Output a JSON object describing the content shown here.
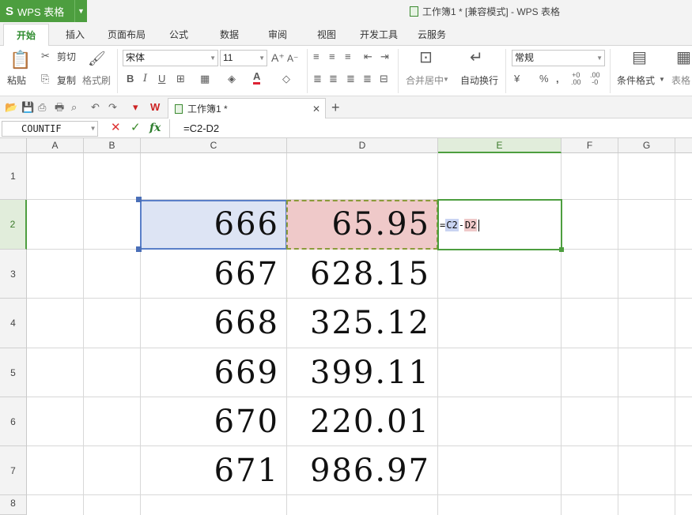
{
  "app": {
    "menu_label": "WPS 表格",
    "window_title": "工作簿1 * [兼容模式] - WPS 表格"
  },
  "tabs": [
    "开始",
    "插入",
    "页面布局",
    "公式",
    "数据",
    "审阅",
    "视图",
    "开发工具",
    "云服务"
  ],
  "ribbon": {
    "paste": "粘贴",
    "cut": "剪切",
    "copy": "复制",
    "format_painter": "格式刷",
    "font_name": "宋体",
    "font_size": "11",
    "merge_center": "合并居中",
    "wrap_text": "自动换行",
    "number_format": "常规",
    "conditional_format": "条件格式",
    "table_style": "表格"
  },
  "document_tab": {
    "name": "工作簿1 *"
  },
  "formula_bar": {
    "name_box": "COUNTIF",
    "fx": "fx",
    "formula": "=C2-D2"
  },
  "sheet": {
    "columns": [
      "A",
      "B",
      "C",
      "D",
      "E",
      "F",
      "G"
    ],
    "rows": [
      "1",
      "2",
      "3",
      "4",
      "5",
      "6",
      "7",
      "8"
    ],
    "selected_column": "E",
    "selected_row": "2",
    "values": {
      "C2": "666",
      "D2": "65.95",
      "C3": "667",
      "D3": "628.15",
      "C4": "668",
      "D4": "325.12",
      "C5": "669",
      "D5": "399.11",
      "C6": "670",
      "D6": "220.01",
      "C7": "671",
      "D7": "986.97"
    },
    "edit_cell": {
      "eq": "=",
      "ref1": "C2",
      "op": "-",
      "ref2": "D2"
    }
  },
  "colors": {
    "accent": "#4d9e3f",
    "ref1_highlight": "#dde4f4",
    "ref2_highlight": "#efc9c9"
  }
}
